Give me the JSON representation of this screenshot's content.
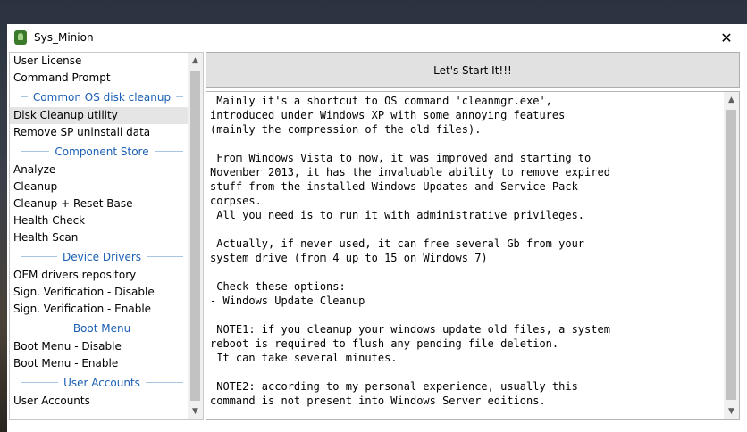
{
  "window": {
    "title": "Sys_Minion",
    "close_glyph": "✕"
  },
  "sidebar": {
    "top_items": [
      {
        "label": "User License"
      },
      {
        "label": "Command Prompt"
      }
    ],
    "sections": [
      {
        "header": "Common OS disk cleanup",
        "items": [
          {
            "label": "Disk Cleanup utility",
            "selected": true
          },
          {
            "label": "Remove SP uninstall data"
          }
        ]
      },
      {
        "header": "Component Store",
        "items": [
          {
            "label": "Analyze"
          },
          {
            "label": "Cleanup"
          },
          {
            "label": "Cleanup + Reset Base"
          },
          {
            "label": "Health Check"
          },
          {
            "label": "Health Scan"
          }
        ]
      },
      {
        "header": "Device Drivers",
        "items": [
          {
            "label": "OEM drivers repository"
          },
          {
            "label": "Sign. Verification - Disable"
          },
          {
            "label": "Sign. Verification - Enable"
          }
        ]
      },
      {
        "header": "Boot Menu",
        "items": [
          {
            "label": "Boot Menu - Disable"
          },
          {
            "label": "Boot Menu - Enable"
          }
        ]
      },
      {
        "header": "User Accounts",
        "items": [
          {
            "label": "User Accounts"
          }
        ]
      }
    ]
  },
  "main": {
    "start_label": "Let's Start It!!!",
    "description": " Mainly it's a shortcut to OS command 'cleanmgr.exe',\nintroduced under Windows XP with some annoying features\n(mainly the compression of the old files).\n\n From Windows Vista to now, it was improved and starting to\nNovember 2013, it has the invaluable ability to remove expired\nstuff from the installed Windows Updates and Service Pack\ncorpses.\n All you need is to run it with administrative privileges.\n\n Actually, if never used, it can free several Gb from your\nsystem drive (from 4 up to 15 on Windows 7)\n\n Check these options:\n- Windows Update Cleanup\n\n NOTE1: if you cleanup your windows update old files, a system\nreboot is required to flush any pending file deletion.\n It can take several minutes.\n\n NOTE2: according to my personal experience, usually this\ncommand is not present into Windows Server editions."
  },
  "scroll": {
    "up_glyph": "▲",
    "down_glyph": "▼"
  }
}
